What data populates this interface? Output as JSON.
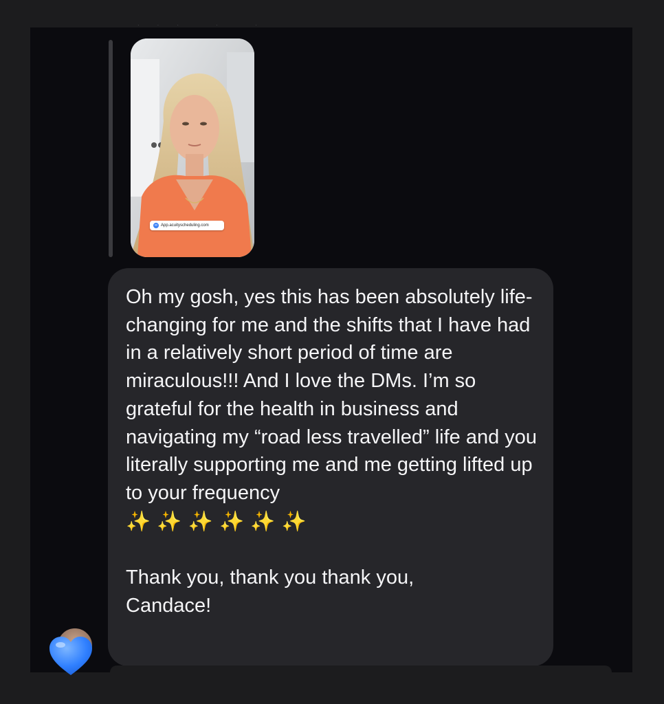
{
  "story_reply": {
    "link_sticker_text": "App.acuityscheduling.com",
    "link_icon": "link-icon"
  },
  "message": {
    "text": "Oh my gosh, yes this has been absolutely life-changing for me and the shifts that I have had in a relatively short period of time are miraculous!!! And I love the DMs. I’m so grateful for the health in business and navigating my “road less travelled” life and you literally supporting me and me getting lifted up to your frequency",
    "sparkles": "✨ ✨ ✨ ✨ ✨ ✨",
    "closing": "Thank you, thank you thank you,\nCandace!"
  },
  "reaction": {
    "emoji": "💙",
    "icon": "blue-heart-icon"
  },
  "colors": {
    "background": "#1c1c1e",
    "chat_background": "#0b0b0f",
    "bubble": "#26262a",
    "text": "#f5f5f7",
    "reaction": "#2f7fff"
  }
}
